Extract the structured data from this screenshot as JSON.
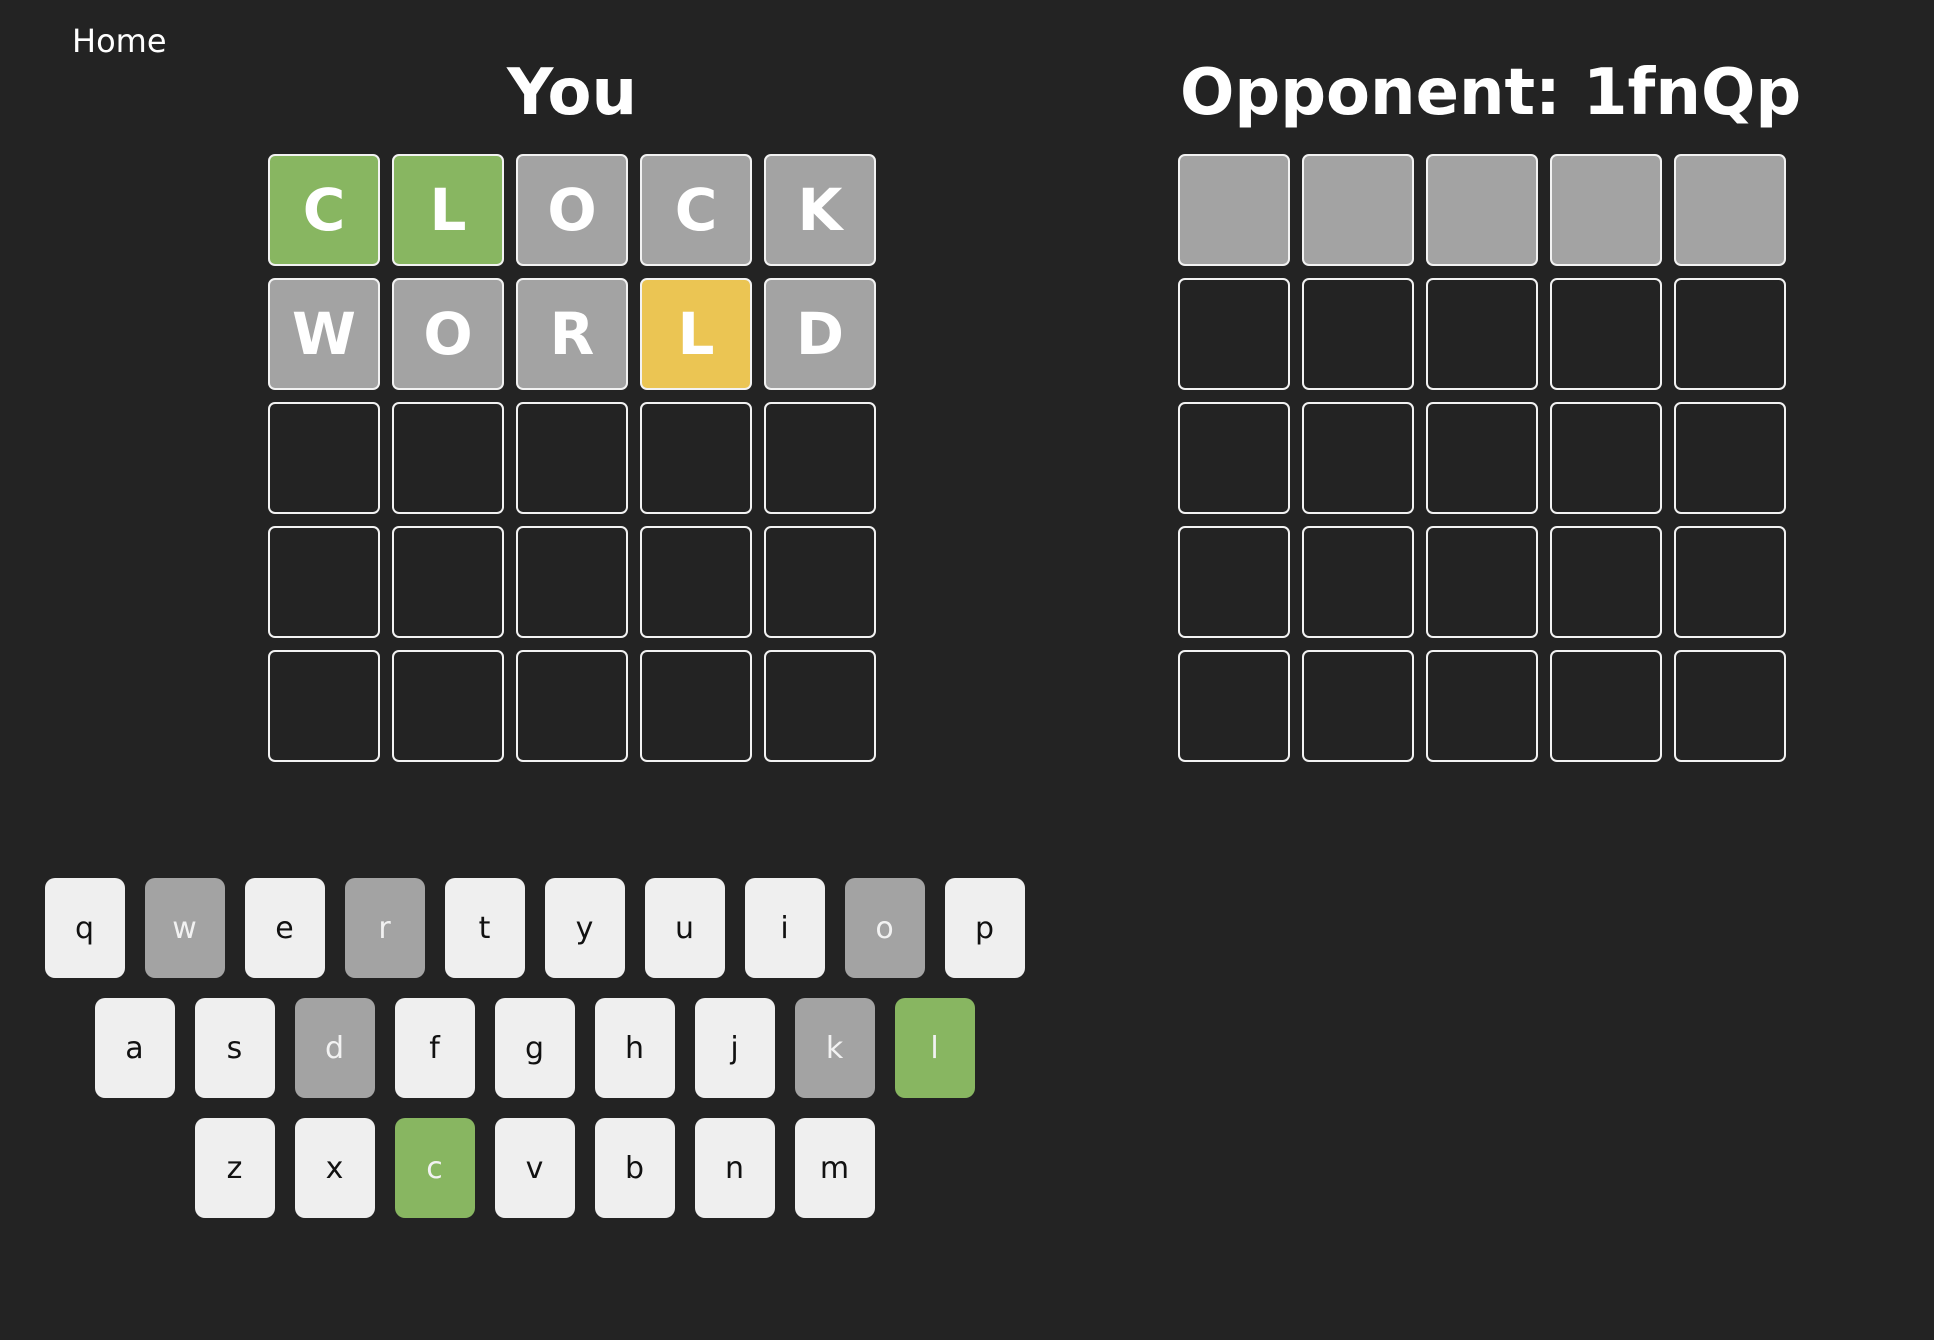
{
  "nav": {
    "home_label": "Home"
  },
  "colors": {
    "background": "#232323",
    "correct": "#88b661",
    "present": "#ebc553",
    "absent": "#a3a3a3",
    "key_default": "#efefef"
  },
  "you": {
    "title": "You",
    "rows": [
      [
        {
          "letter": "C",
          "state": "correct"
        },
        {
          "letter": "L",
          "state": "correct"
        },
        {
          "letter": "O",
          "state": "absent"
        },
        {
          "letter": "C",
          "state": "absent"
        },
        {
          "letter": "K",
          "state": "absent"
        }
      ],
      [
        {
          "letter": "W",
          "state": "absent"
        },
        {
          "letter": "O",
          "state": "absent"
        },
        {
          "letter": "R",
          "state": "absent"
        },
        {
          "letter": "L",
          "state": "present"
        },
        {
          "letter": "D",
          "state": "absent"
        }
      ],
      [
        {
          "letter": "",
          "state": "empty"
        },
        {
          "letter": "",
          "state": "empty"
        },
        {
          "letter": "",
          "state": "empty"
        },
        {
          "letter": "",
          "state": "empty"
        },
        {
          "letter": "",
          "state": "empty"
        }
      ],
      [
        {
          "letter": "",
          "state": "empty"
        },
        {
          "letter": "",
          "state": "empty"
        },
        {
          "letter": "",
          "state": "empty"
        },
        {
          "letter": "",
          "state": "empty"
        },
        {
          "letter": "",
          "state": "empty"
        }
      ],
      [
        {
          "letter": "",
          "state": "empty"
        },
        {
          "letter": "",
          "state": "empty"
        },
        {
          "letter": "",
          "state": "empty"
        },
        {
          "letter": "",
          "state": "empty"
        },
        {
          "letter": "",
          "state": "empty"
        }
      ]
    ]
  },
  "opponent": {
    "title": "Opponent: 1fnQp",
    "rows": [
      [
        {
          "letter": "",
          "state": "hidden"
        },
        {
          "letter": "",
          "state": "hidden"
        },
        {
          "letter": "",
          "state": "hidden"
        },
        {
          "letter": "",
          "state": "hidden"
        },
        {
          "letter": "",
          "state": "hidden"
        }
      ],
      [
        {
          "letter": "",
          "state": "empty"
        },
        {
          "letter": "",
          "state": "empty"
        },
        {
          "letter": "",
          "state": "empty"
        },
        {
          "letter": "",
          "state": "empty"
        },
        {
          "letter": "",
          "state": "empty"
        }
      ],
      [
        {
          "letter": "",
          "state": "empty"
        },
        {
          "letter": "",
          "state": "empty"
        },
        {
          "letter": "",
          "state": "empty"
        },
        {
          "letter": "",
          "state": "empty"
        },
        {
          "letter": "",
          "state": "empty"
        }
      ],
      [
        {
          "letter": "",
          "state": "empty"
        },
        {
          "letter": "",
          "state": "empty"
        },
        {
          "letter": "",
          "state": "empty"
        },
        {
          "letter": "",
          "state": "empty"
        },
        {
          "letter": "",
          "state": "empty"
        }
      ],
      [
        {
          "letter": "",
          "state": "empty"
        },
        {
          "letter": "",
          "state": "empty"
        },
        {
          "letter": "",
          "state": "empty"
        },
        {
          "letter": "",
          "state": "empty"
        },
        {
          "letter": "",
          "state": "empty"
        }
      ]
    ]
  },
  "keyboard": {
    "rows": [
      [
        {
          "key": "q",
          "state": "default"
        },
        {
          "key": "w",
          "state": "absent"
        },
        {
          "key": "e",
          "state": "default"
        },
        {
          "key": "r",
          "state": "absent"
        },
        {
          "key": "t",
          "state": "default"
        },
        {
          "key": "y",
          "state": "default"
        },
        {
          "key": "u",
          "state": "default"
        },
        {
          "key": "i",
          "state": "default"
        },
        {
          "key": "o",
          "state": "absent"
        },
        {
          "key": "p",
          "state": "default"
        }
      ],
      [
        {
          "key": "a",
          "state": "default"
        },
        {
          "key": "s",
          "state": "default"
        },
        {
          "key": "d",
          "state": "absent"
        },
        {
          "key": "f",
          "state": "default"
        },
        {
          "key": "g",
          "state": "default"
        },
        {
          "key": "h",
          "state": "default"
        },
        {
          "key": "j",
          "state": "default"
        },
        {
          "key": "k",
          "state": "absent"
        },
        {
          "key": "l",
          "state": "correct"
        }
      ],
      [
        {
          "key": "z",
          "state": "default"
        },
        {
          "key": "x",
          "state": "default"
        },
        {
          "key": "c",
          "state": "correct"
        },
        {
          "key": "v",
          "state": "default"
        },
        {
          "key": "b",
          "state": "default"
        },
        {
          "key": "n",
          "state": "default"
        },
        {
          "key": "m",
          "state": "default"
        }
      ]
    ]
  }
}
